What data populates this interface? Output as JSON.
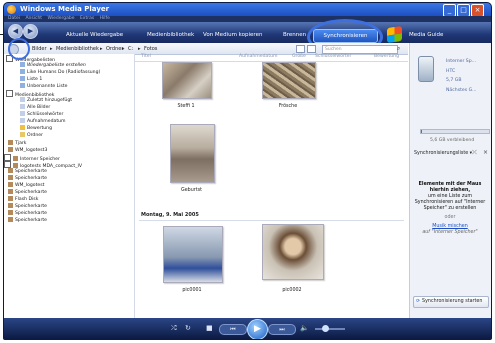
{
  "window": {
    "title": "Windows Media Player"
  },
  "menu": [
    "Datei",
    "Ansicht",
    "Wiedergabe",
    "Extras",
    "Hilfe"
  ],
  "tabs": [
    "Aktuelle Wiedergabe",
    "Medienbibliothek",
    "Von Medium kopieren",
    "Brennen",
    "Synchronisieren",
    "Media Guide"
  ],
  "breadcrumb": [
    "Bilder",
    "Medienbibliothek",
    "Ordner",
    "C:",
    "Fotos"
  ],
  "search": {
    "placeholder": "Suchen"
  },
  "tree": [
    "Wiedergabelisten",
    "Wiedergabeliste erstellen",
    "Like Humans Do (Radiofassung)",
    "Liste 1",
    "Unbenannte Liste",
    "Medienbibliothek",
    "Zuletzt hinzugefügt",
    "Alle Bilder",
    "Schlüsselwörter",
    "Aufnahmedatum",
    "Bewertung",
    "Ordner",
    "Tjark",
    "WM_logotest3",
    "Interner Speicher",
    "logotests MDA_compact_IV",
    "Speicherkarte",
    "Speicherkarte",
    "WM_logotest",
    "Speicherkarte",
    "Flash Disk",
    "Speicherkarte",
    "Speicherkarte",
    "Speicherkarte"
  ],
  "columns": [
    "Titel",
    "Aufnahmedatum",
    "Größe",
    "Schlüsselwörter",
    "Bewertung"
  ],
  "photos": [
    {
      "caption": "Steffi 1"
    },
    {
      "caption": "Frösche"
    },
    {
      "caption": "Geburtst"
    },
    {
      "caption": "pic0001"
    },
    {
      "caption": "pic0002"
    }
  ],
  "group_header": "Montag, 9. Mai 2005",
  "device": {
    "name": "Interner Sp...",
    "model": "HTC",
    "capacity": "5,7 GB",
    "next": "Nächstes G...",
    "remaining": "5,6 GB verbleibend",
    "used_fraction": 0.02
  },
  "sync": {
    "list_label": "Synchronisierungsliste",
    "drop_title": "Elemente mit der Maus hierhin ziehen,",
    "drop_body": "um eine Liste zum Synchronisieren auf \"Interner Speicher\" zu erstellen",
    "or": "oder",
    "shuffle_link": "Musik mischen",
    "shuffle_target": "auf \"Interner Speicher\"",
    "start_button": "Synchronisierung starten"
  },
  "colors": {
    "frame": "#2a3f70",
    "accent": "#3d6fe0",
    "pane": "#eef2f8"
  }
}
